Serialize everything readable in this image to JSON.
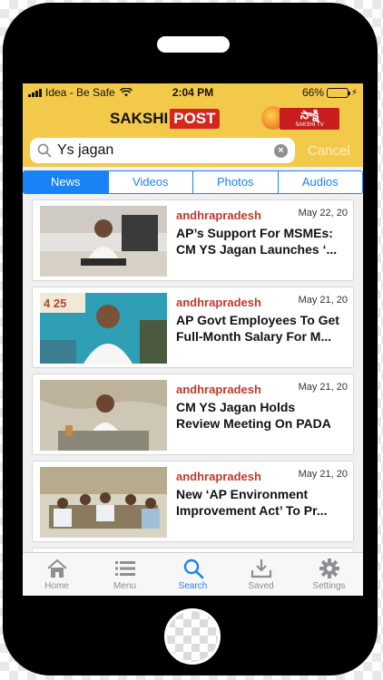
{
  "status": {
    "carrier": "Idea - Be Safe",
    "time": "2:04 PM",
    "battery": "66%",
    "battery_fraction": 0.66
  },
  "header": {
    "logo_a": "SAKSHI",
    "logo_b": "POST",
    "tv_main": "సాక్షి",
    "tv_sub": "SAKSHI TV"
  },
  "search": {
    "value": "Ys jagan",
    "cancel": "Cancel"
  },
  "tabs": [
    "News",
    "Videos",
    "Photos",
    "Audios"
  ],
  "articles": [
    {
      "category": "andhrapradesh",
      "date": "May 22, 20",
      "title": "AP’s Support For MSMEs:\nCM YS Jagan Launches ‘..."
    },
    {
      "category": "andhrapradesh",
      "date": "May 21, 20",
      "title": "AP Govt Employees To Get\nFull-Month Salary For M..."
    },
    {
      "category": "andhrapradesh",
      "date": "May 21, 20",
      "title": "CM YS Jagan Holds\nReview Meeting On PADA"
    },
    {
      "category": "andhrapradesh",
      "date": "May 21, 20",
      "title": "New ‘AP Environment\nImprovement Act’ To Pr..."
    }
  ],
  "thumb2_text": "4 25",
  "bottom_tabs": [
    "Home",
    "Menu",
    "Search",
    "Saved",
    "Settings"
  ],
  "colors": {
    "accent": "#1a82f7",
    "header": "#f3c94a",
    "category": "#c0392b"
  }
}
